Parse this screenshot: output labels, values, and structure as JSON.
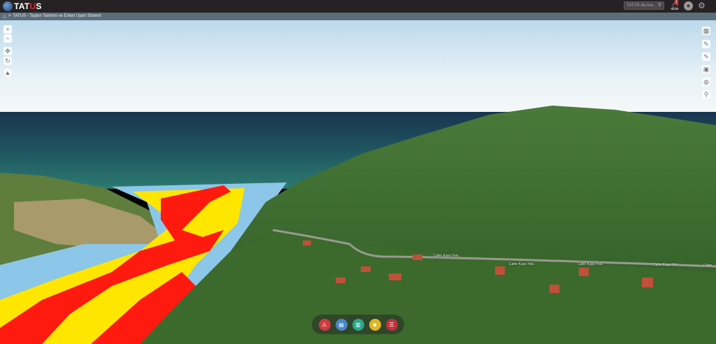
{
  "app": {
    "logo_prefix": "TAT",
    "logo_u": "U",
    "logo_suffix": "S"
  },
  "header": {
    "search_placeholder": "TATUS da Ara...",
    "notifications_count": "1"
  },
  "breadcrumb": {
    "separator": ">",
    "title": "TATUS - Taşkın Tahmini ve Erken Uyarı Sistemi"
  },
  "map": {
    "road_labels": [
      "Cafer Kaya Yolu",
      "Cafer Kaya Yolu",
      "Cafer Kaya Yolu",
      "Cafer Kaya Yolu",
      "Cafer"
    ]
  },
  "colors": {
    "topbar": "#262224",
    "accent": "#e0262d",
    "flood_red": "#ff1010",
    "flood_yellow": "#ffee00"
  },
  "left_controls": [
    "zoom-in",
    "zoom-out",
    "pan",
    "rotate",
    "compass"
  ],
  "right_controls": [
    "basemap",
    "draw-line",
    "draw-polygon",
    "report",
    "globe",
    "location"
  ],
  "bottom_tools": [
    {
      "name": "alert",
      "color": "#d23a41",
      "icon": "⚠"
    },
    {
      "name": "document",
      "color": "#4a86c8",
      "icon": "▤"
    },
    {
      "name": "file",
      "color": "#2aa88a",
      "icon": "▥"
    },
    {
      "name": "users",
      "color": "#e0b624",
      "icon": "☻"
    },
    {
      "name": "list",
      "color": "#c2303b",
      "icon": "☰"
    }
  ]
}
